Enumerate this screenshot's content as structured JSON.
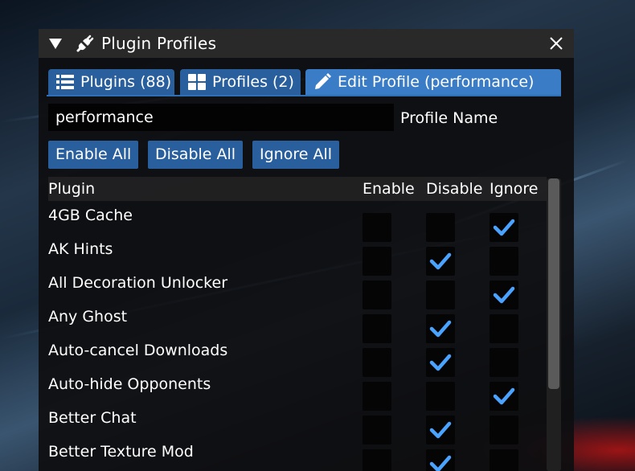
{
  "window": {
    "title": "Plugin Profiles",
    "accent": "#3a7cc6",
    "check_color": "#4aa3ff"
  },
  "tabs": [
    {
      "label": "Plugins (88)",
      "icon": "list-icon",
      "active": false
    },
    {
      "label": "Profiles (2)",
      "icon": "grid-icon",
      "active": false
    },
    {
      "label": "Edit Profile (performance)",
      "icon": "pencil-icon",
      "active": true
    }
  ],
  "profile": {
    "name_value": "performance",
    "name_label": "Profile Name"
  },
  "actions": {
    "enable_all": "Enable All",
    "disable_all": "Disable All",
    "ignore_all": "Ignore All"
  },
  "table": {
    "headers": {
      "plugin": "Plugin",
      "enable": "Enable",
      "disable": "Disable",
      "ignore": "Ignore"
    },
    "rows": [
      {
        "name": "4GB Cache",
        "state": "ignore"
      },
      {
        "name": "AK Hints",
        "state": "disable"
      },
      {
        "name": "All Decoration Unlocker",
        "state": "ignore"
      },
      {
        "name": "Any Ghost",
        "state": "disable"
      },
      {
        "name": "Auto-cancel Downloads",
        "state": "disable"
      },
      {
        "name": "Auto-hide Opponents",
        "state": "ignore"
      },
      {
        "name": "Better Chat",
        "state": "disable"
      },
      {
        "name": "Better Texture Mod",
        "state": "disable"
      }
    ]
  }
}
